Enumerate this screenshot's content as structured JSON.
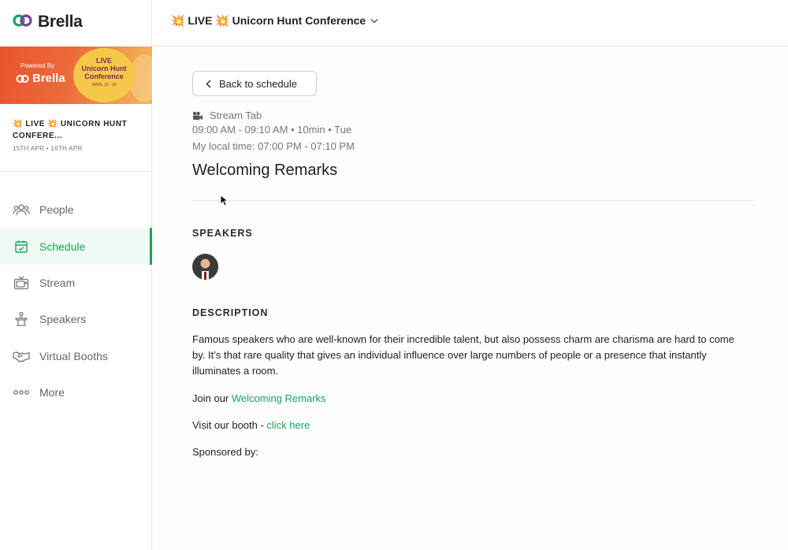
{
  "brand": {
    "name": "Brella",
    "logo_icon": "brella-logo-icon"
  },
  "banner": {
    "powered_by": "Powered By",
    "brand": "Brella",
    "live": "LIVE",
    "conference_line1": "Unicorn Hunt",
    "conference_line2": "Conference",
    "dates": "APRIL 15 - 16"
  },
  "event": {
    "title": "💥 LIVE 💥 UNICORN HUNT CONFERE...",
    "dates": "15TH APR • 16TH APR"
  },
  "nav": [
    {
      "label": "People",
      "icon": "people-icon",
      "active": false
    },
    {
      "label": "Schedule",
      "icon": "calendar-icon",
      "active": true
    },
    {
      "label": "Stream",
      "icon": "tv-icon",
      "active": false
    },
    {
      "label": "Speakers",
      "icon": "podium-icon",
      "active": false
    },
    {
      "label": "Virtual Booths",
      "icon": "handshake-icon",
      "active": false
    },
    {
      "label": "More",
      "icon": "more-dots-icon",
      "active": false
    }
  ],
  "topbar": {
    "conference": "💥 LIVE 💥 Unicorn Hunt Conference"
  },
  "session": {
    "back_label": "Back to schedule",
    "stream_tab": "Stream Tab",
    "time": "09:00 AM - 09:10 AM • 10min • Tue",
    "local_time": "My local time: 07:00 PM - 07:10 PM",
    "title": "Welcoming Remarks",
    "speakers_heading": "SPEAKERS",
    "description_heading": "DESCRIPTION",
    "description": "Famous speakers who are well-known for their incredible talent, but also possess charm are charisma are hard to come by. It’s that rare quality that gives an individual influence over large numbers of people or a presence that instantly illuminates a room.",
    "join_prefix": "Join our ",
    "join_link": "Welcoming Remarks",
    "booth_prefix": "Visit our booth - ",
    "booth_link": "click here",
    "sponsored": "Sponsored by:"
  },
  "colors": {
    "accent": "#17a558",
    "active_bg": "#eefaf3",
    "banner_orange": "#e8552f",
    "banner_yellow": "#f6c84a"
  }
}
